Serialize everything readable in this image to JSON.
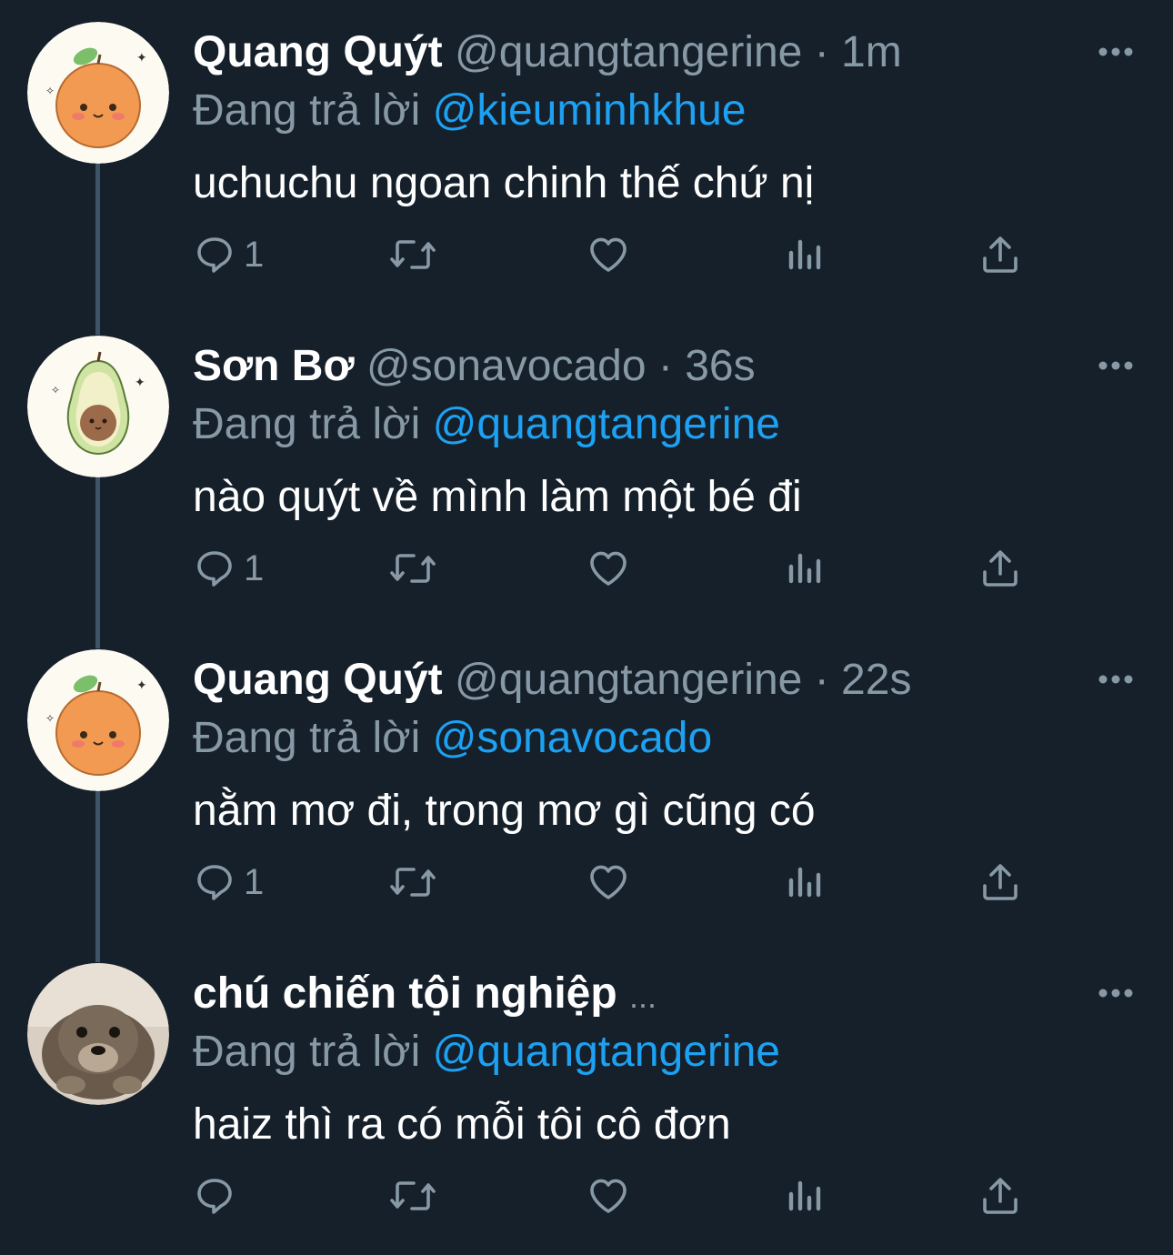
{
  "colors": {
    "background": "#15202b",
    "primary_text": "#ffffff",
    "secondary_text": "#8899a6",
    "mention": "#1da1f2",
    "thread_line": "#3d5466"
  },
  "tweets": [
    {
      "avatar": "tangerine-avatar",
      "display_name": "Quang Quýt",
      "handle": "@quangtangerine",
      "separator": "·",
      "time": "1m",
      "reply_prefix": "Đang trả lời",
      "reply_to": "@kieuminhkhue",
      "text": "uchuchu ngoan chinh thế chứ nị",
      "reply_count": "1"
    },
    {
      "avatar": "avocado-avatar",
      "display_name": "Sơn Bơ",
      "handle": "@sonavocado",
      "separator": "·",
      "time": "36s",
      "reply_prefix": "Đang trả lời",
      "reply_to": "@quangtangerine",
      "text": "nào quýt về mình làm một bé đi",
      "reply_count": "1"
    },
    {
      "avatar": "tangerine-avatar",
      "display_name": "Quang Quýt",
      "handle": "@quangtangerine",
      "separator": "·",
      "time": "22s",
      "reply_prefix": "Đang trả lời",
      "reply_to": "@sonavocado",
      "text": "nằm mơ đi, trong mơ gì cũng có",
      "reply_count": "1"
    },
    {
      "avatar": "otter-avatar",
      "display_name": "chú chiến tội nghiệp",
      "ellipsis": "...",
      "reply_prefix": "Đang trả lời",
      "reply_to": "@quangtangerine",
      "text": "haiz thì ra có mỗi tôi cô đơn",
      "reply_count": ""
    }
  ],
  "icons": {
    "reply": "reply-icon",
    "retweet": "retweet-icon",
    "like": "heart-icon",
    "analytics": "analytics-icon",
    "share": "share-icon",
    "more": "more-icon"
  }
}
